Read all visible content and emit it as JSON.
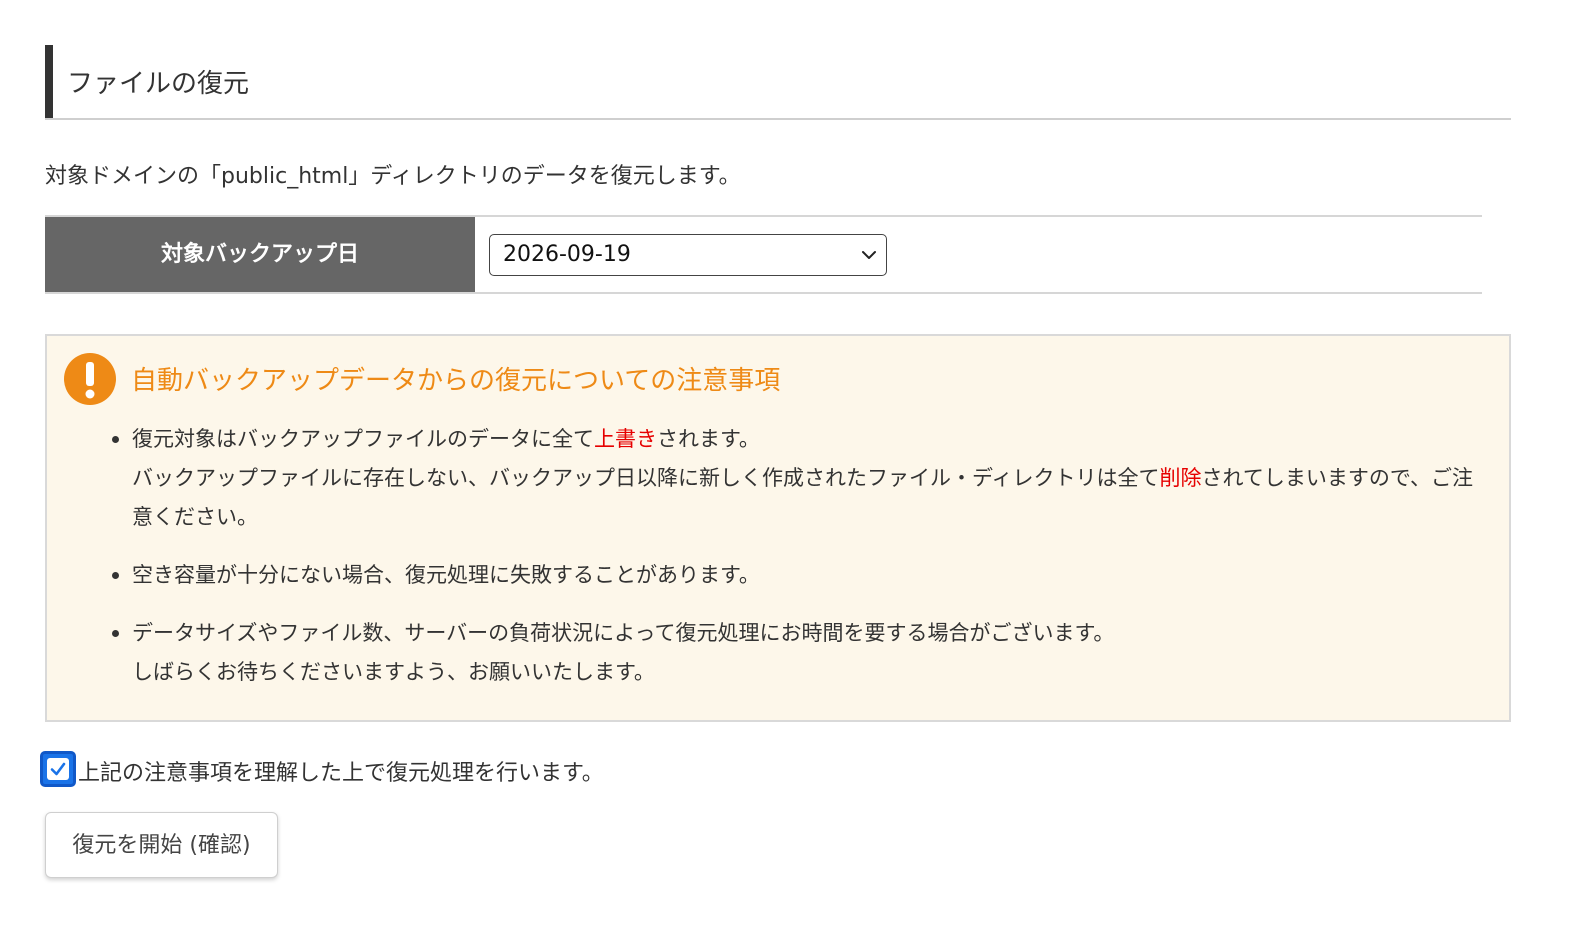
{
  "page": {
    "title": "ファイルの復元",
    "description": "対象ドメインの「public_html」ディレクトリのデータを復元します。"
  },
  "form": {
    "backup_date_label": "対象バックアップ日",
    "backup_date_value": "2026-09-19"
  },
  "notice": {
    "heading": "自動バックアップデータからの復元についての注意事項",
    "items": [
      {
        "line1_before": "復元対象はバックアップファイルのデータに全て",
        "line1_highlight": "上書き",
        "line1_after": "されます。",
        "line2_before": "バックアップファイルに存在しない、バックアップ日以降に新しく作成されたファイル・ディレクトリは全て",
        "line2_highlight": "削除",
        "line2_after": "されてしまいますので、ご注意ください。"
      },
      {
        "text": "空き容量が十分にない場合、復元処理に失敗することがあります。"
      },
      {
        "line1": "データサイズやファイル数、サーバーの負荷状況によって復元処理にお時間を要する場合がございます。",
        "line2": "しばらくお待ちくださいますよう、お願いいたします。"
      }
    ]
  },
  "agree": {
    "checked": true,
    "label": "上記の注意事項を理解した上で復元処理を行います。"
  },
  "actions": {
    "start_label": "復元を開始 (確認)"
  },
  "colors": {
    "accent_orange": "#ee8a16",
    "highlight_red": "#e60000",
    "header_gray": "#666666",
    "notice_bg": "#fdf7ea",
    "checkbox_blue": "#1a73e8"
  },
  "icons": {
    "warning": "exclamation-circle-icon",
    "select": "chevron-down-icon",
    "checkbox": "checkmark-icon"
  }
}
